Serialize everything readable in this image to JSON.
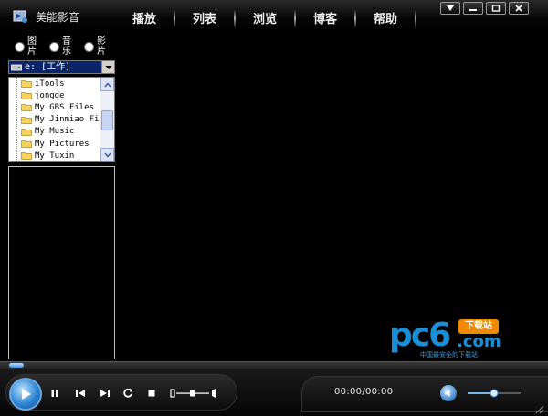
{
  "app": {
    "title": "美能影音"
  },
  "menu": [
    {
      "label": "播放"
    },
    {
      "label": "列表"
    },
    {
      "label": "浏览"
    },
    {
      "label": "博客"
    },
    {
      "label": "帮助"
    }
  ],
  "window_controls": [
    "dropdown-icon",
    "minimize-icon",
    "maximize-icon",
    "close-icon"
  ],
  "media_type": {
    "options": [
      {
        "label": "图片",
        "selected": false
      },
      {
        "label": "音乐",
        "selected": false
      },
      {
        "label": "影片",
        "selected": false
      }
    ]
  },
  "drive_select": {
    "value": "e: [工作]"
  },
  "folders": [
    "iTools",
    "jongde",
    "My GBS Files",
    "My Jinmiao Fi",
    "My Music",
    "My Pictures",
    "My Tuxin"
  ],
  "watermark": {
    "brand": "pc6",
    "badge": "下载站",
    "domain": ".com",
    "tagline": "中国最安全的下载站"
  },
  "player": {
    "time": "00:00/00:00",
    "seek_progress": 0.0,
    "volume": 0.5,
    "balance": 0.5
  },
  "colors": {
    "accent": "#2f86d6",
    "selection": "#0a246a",
    "folder": "#f6d35f",
    "watermark_blue": "#1a8fd8",
    "watermark_orange": "#f08a00"
  }
}
